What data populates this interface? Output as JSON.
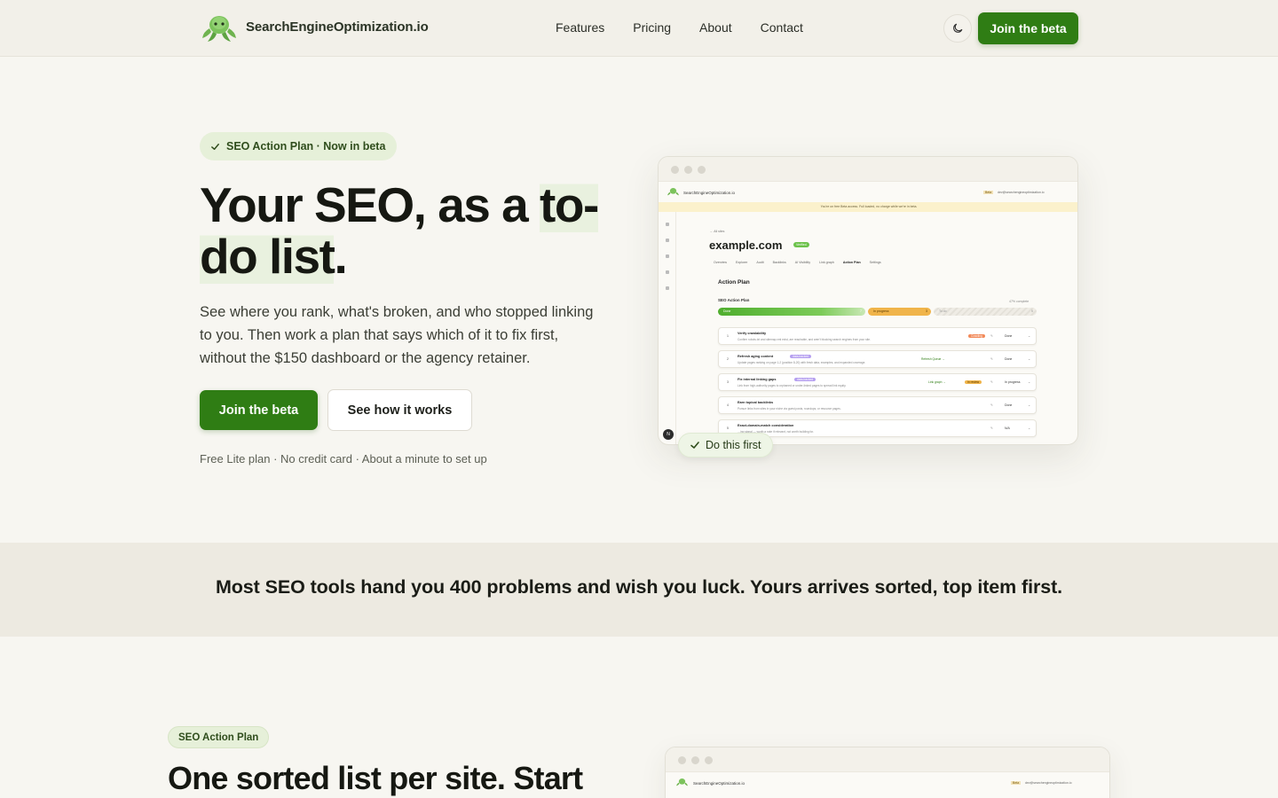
{
  "brand": {
    "name": "SearchEngineOptimization.io"
  },
  "nav": {
    "links": [
      "Features",
      "Pricing",
      "About",
      "Contact"
    ],
    "theme_icon": "moon-icon",
    "cta": "Join the beta"
  },
  "hero": {
    "pill": "SEO Action Plan · Now in beta",
    "title_part1": "Your SEO, as a ",
    "title_hl1": "to-",
    "title_hl2": "do list",
    "title_end": ".",
    "subtitle": "See where you rank, what's broken, and who stopped linking to you. Then work a plan that says which of it to fix first, without the $150 dashboard or the agency retainer.",
    "primary_cta": "Join the beta",
    "secondary_cta": "See how it works",
    "fineprint": "Free Lite plan · No credit card · About a minute to set up"
  },
  "mockup": {
    "brand": "SearchEngineOptimization.io",
    "beta_badge": "Beta",
    "email": "dev@searchengineoptimization.io",
    "notice": "You're on free Beta access. Full loaded, no charge while we're in beta.",
    "back_link": "← All sites",
    "site": "example.com",
    "verified": "Verified",
    "tabs": [
      "Overview",
      "Explorer",
      "Audit",
      "Backlinks",
      "AI Visibility",
      "Link graph",
      "Action Plan",
      "Settings"
    ],
    "active_tab": "Action Plan",
    "heading": "Action Plan",
    "plan_title": "SEO Action Plan",
    "percent_complete": "47% complete",
    "progress": [
      {
        "label": "Done",
        "count": "7"
      },
      {
        "label": "In progress",
        "count": "3"
      },
      {
        "label": "To do",
        "count": "5"
      }
    ],
    "rows": [
      {
        "num": "1",
        "title": "Verify crawlability",
        "desc": "Confirm robots.txt and sitemap.xml exist, are reachable, and aren't blocking search engines from your site.",
        "tag": "Crawling",
        "link": "",
        "status": "Done"
      },
      {
        "num": "2",
        "title": "Refresh aging content",
        "desc": "Update pages ranking on page 1-2 (position 8-20) with fresh data, examples, and expanded coverage.",
        "tag": "data-backed",
        "link": "Refresh Queue →",
        "status": "Done"
      },
      {
        "num": "3",
        "title": "Fix internal linking gaps",
        "desc": "Link from high-authority pages to orphaned or under-linked pages to spread link equity.",
        "tag": "data-backed",
        "link": "Link graph →",
        "status": "In progress"
      },
      {
        "num": "4",
        "title": "Earn topical backlinks",
        "desc": "Pursue links from sites in your niche via guest posts, roundups, or resource pages.",
        "tag": "",
        "link": "",
        "status": "Done"
      },
      {
        "num": "5",
        "title": "Exact-domain-match consideration",
        "desc": "…ing signal — worth a note if relevant, not worth building for.",
        "tag": "",
        "link": "",
        "status": "N/A"
      }
    ],
    "avatar_letter": "N",
    "floating_badge": "Do this first"
  },
  "band": {
    "text": "Most SEO tools hand you 400 problems and wish you luck. Yours arrives sorted, top item first."
  },
  "section2": {
    "pill": "SEO Action Plan",
    "title": "One sorted list per site. Start",
    "mock_brand": "SearchEngineOptimization.io",
    "mock_beta": "Beta",
    "mock_email": "dev@searchengineoptimization.io"
  },
  "colors": {
    "accent": "#2f7d14",
    "pill_bg": "#e6f0d9",
    "background": "#f7f6f1",
    "band_bg": "#edeae1"
  }
}
